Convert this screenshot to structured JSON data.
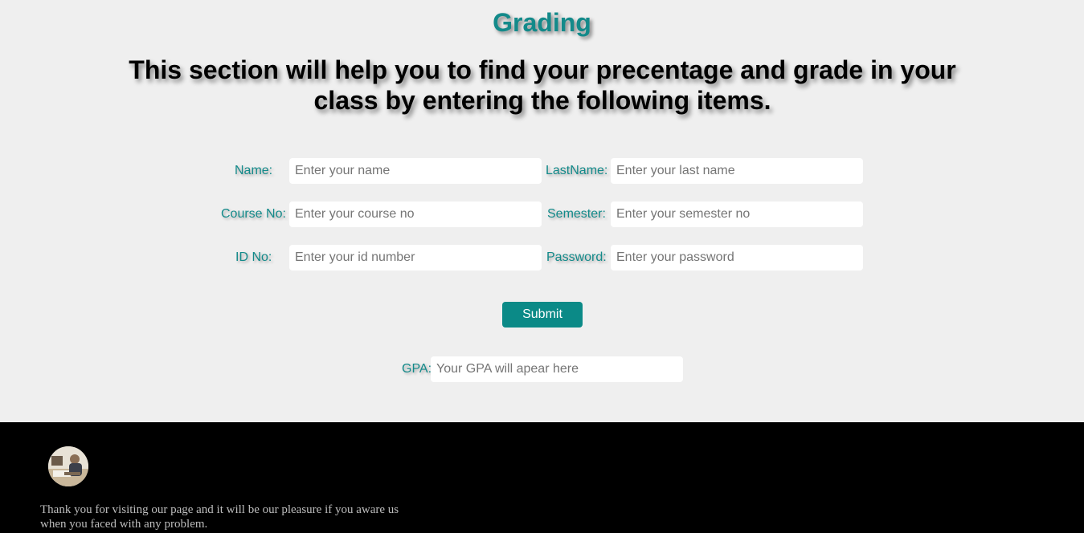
{
  "header": {
    "title": "Grading",
    "subtitle": "This section will help you to find your precentage and grade in your class by entering the following items."
  },
  "form": {
    "name": {
      "label": "Name:",
      "placeholder": "Enter your name"
    },
    "lastname": {
      "label": "LastName:",
      "placeholder": "Enter your last name"
    },
    "course_no": {
      "label": "Course No:",
      "placeholder": "Enter your course no"
    },
    "semester": {
      "label": "Semester:",
      "placeholder": "Enter your semester no"
    },
    "id_no": {
      "label": "ID No:",
      "placeholder": "Enter your id number"
    },
    "password": {
      "label": "Password:",
      "placeholder": "Enter your password"
    },
    "submit_label": "Submit",
    "gpa": {
      "label": "GPA:",
      "placeholder": "Your GPA will apear here"
    }
  },
  "footer": {
    "message": "Thank you for visiting our page and it will be our pleasure if you aware us when you faced with any problem."
  },
  "colors": {
    "accent": "#138a8a",
    "button": "#0b8a87",
    "background": "#efefef",
    "footer": "#000000"
  }
}
